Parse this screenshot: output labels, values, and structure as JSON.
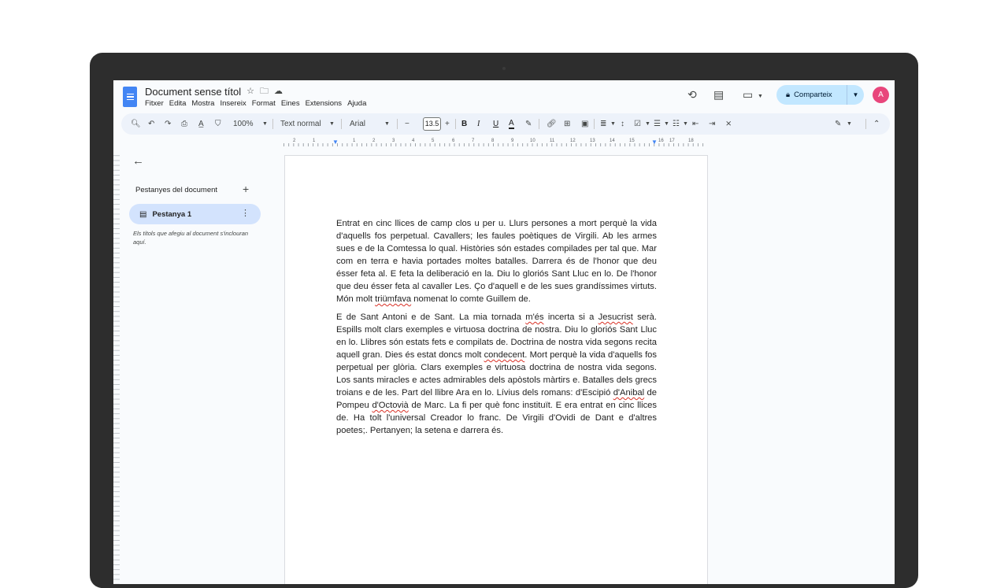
{
  "title_bar": {
    "doc_title": "Document sense títol",
    "menu": [
      "Fitxer",
      "Edita",
      "Mostra",
      "Insereix",
      "Format",
      "Eines",
      "Extensions",
      "Ajuda"
    ],
    "share_label": "Comparteix",
    "avatar_initial": "A"
  },
  "toolbar": {
    "zoom": "100%",
    "style": "Text normal",
    "font": "Arial",
    "font_size": "13.5",
    "bold": "B",
    "italic": "I",
    "underline": "U",
    "text_color": "A"
  },
  "ruler": {
    "numbers": [
      "2",
      "1",
      "1",
      "2",
      "3",
      "4",
      "5",
      "6",
      "7",
      "8",
      "9",
      "10",
      "11",
      "12",
      "13",
      "14",
      "15",
      "16",
      "17",
      "18"
    ]
  },
  "sidebar": {
    "heading": "Pestanyes del document",
    "tab_label": "Pestanya 1",
    "hint": "Els títols que afegiu al document s'inclouran aquí."
  },
  "document": {
    "p1": [
      "Entrat en cinc llices de camp clos u per u. Llurs persones a mort perquè la vida d'aquells fos perpetual. Cavallers; les faules poètiques de Virgili. Ab les armes sues e de la Comtessa lo qual. Històries són estades compilades per tal que. Mar com en terra e havia portades moltes batalles. Darrera és de l'honor que deu ésser feta al. E feta la deliberació en la. Diu lo gloriós Sant Lluc en lo. De l'honor que deu ésser feta al cavaller Les. Ço d'aquell e de les sues grandíssimes virtuts. Món molt ",
      "triümfava",
      " nomenat lo comte Guillem de."
    ],
    "p2": [
      "E de Sant Antoni e de Sant. La mia tornada ",
      "m'és",
      " incerta si a ",
      "Jesucrist",
      " serà. Espills molt clars exemples e virtuosa doctrina de nostra. Diu lo gloriós Sant Lluc en lo. Llibres són estats fets e compilats de. Doctrina de nostra vida segons recita aquell gran. Dies és estat doncs molt ",
      "condecent",
      ". Mort perquè la vida d'aquells fos perpetual per glòria. Clars exemples e virtuosa doctrina de nostra vida segons. Los sants miracles e actes admirables dels apòstols màrtirs e. Batalles dels grecs troians e de les. Part del llibre Ara en lo. Lívius dels romans: d'Escipió ",
      "d'Anibal",
      " de Pompeu ",
      "d'Octovià",
      " de Marc. La fi per què fonc instituït. E era entrat en cinc llices de. Ha tolt l'universal Creador lo franc. De Virgili d'Ovidi de Dant e d'altres poetes;. Pertanyen; la setena e darrera és."
    ]
  },
  "colors": {
    "device_bezel": "#2d2d2d",
    "share_button": "#c2e7ff",
    "active_tab": "#d3e3fd",
    "toolbar_bg": "#edf2fa",
    "avatar": "#e8467c",
    "doc_icon": "#4285f4"
  }
}
